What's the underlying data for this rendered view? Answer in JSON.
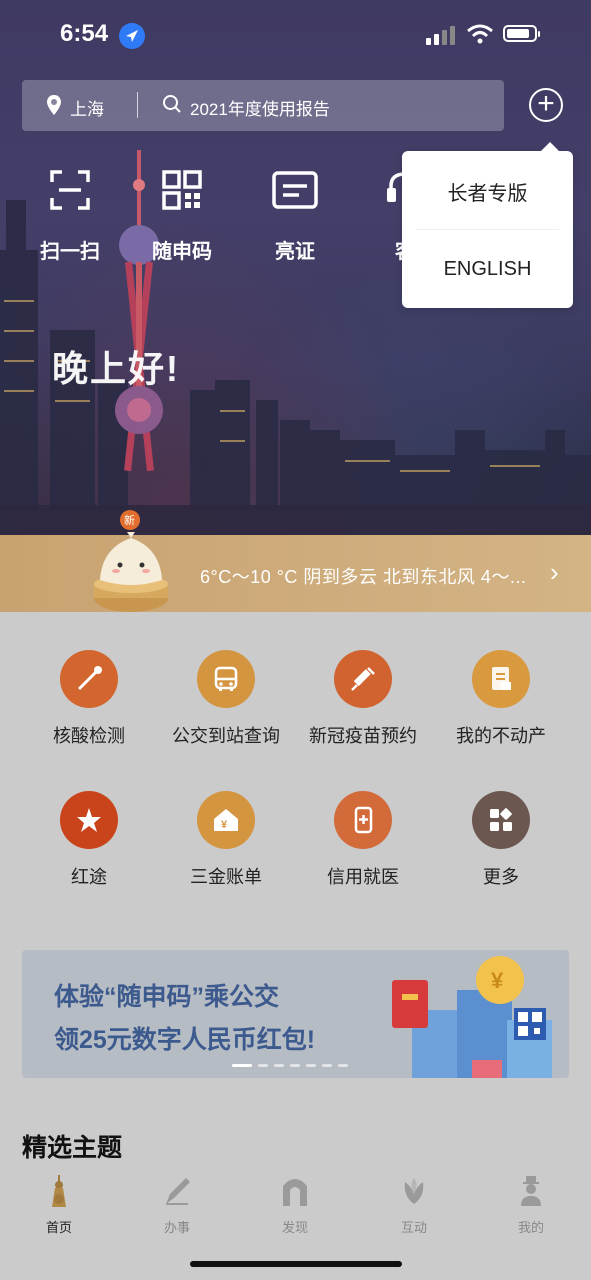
{
  "status_bar": {
    "time": "6:54"
  },
  "search": {
    "city": "上海",
    "placeholder": "2021年度使用报告"
  },
  "quick_actions": [
    "扫一扫",
    "随申码",
    "亮证",
    "客"
  ],
  "greeting": "晚上好!",
  "weather": {
    "badge": "新",
    "text": "6°C～10 °C 阴到多云 北到东北风 4～..."
  },
  "services": [
    {
      "label": "核酸检测",
      "icon": "swab-icon",
      "color": "#d2662e"
    },
    {
      "label": "公交到站查询",
      "icon": "bus-icon",
      "color": "#d49540"
    },
    {
      "label": "新冠疫苗预约",
      "icon": "syringe-icon",
      "color": "#d0632f"
    },
    {
      "label": "我的不动产",
      "icon": "document-icon",
      "color": "#d8993f"
    },
    {
      "label": "红途",
      "icon": "red-star-icon",
      "color": "#c9441a"
    },
    {
      "label": "三金账单",
      "icon": "house-yen-icon",
      "color": "#d49540"
    },
    {
      "label": "信用就医",
      "icon": "phone-medical-icon",
      "color": "#d36a3a"
    },
    {
      "label": "更多",
      "icon": "grid-more-icon",
      "color": "#6c5750"
    }
  ],
  "banner": {
    "line1": "体验“随申码”乘公交",
    "line2": "领25元数字人民币红包!"
  },
  "section_title": "精选主题",
  "tabs": [
    "首页",
    "办事",
    "发现",
    "互动",
    "我的"
  ],
  "popup_menu": [
    "长者专版",
    "ENGLISH"
  ]
}
